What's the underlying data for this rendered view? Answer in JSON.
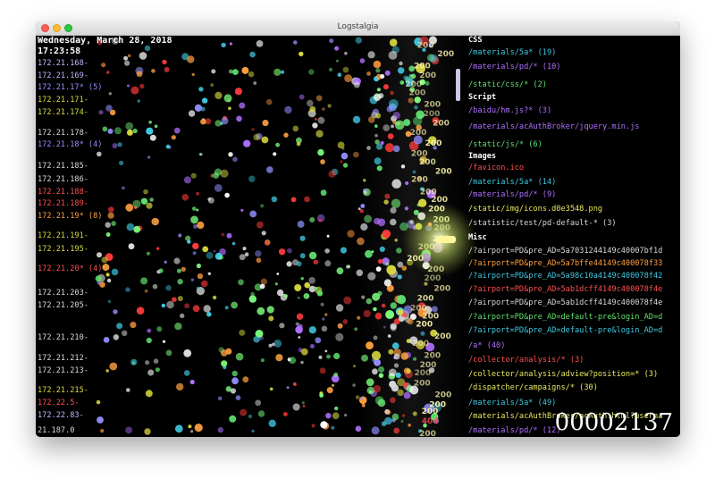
{
  "window": {
    "title": "Logstalgia"
  },
  "clock": {
    "date": "Wednesday, March 28, 2018",
    "time": "17:23:58"
  },
  "hosts": [
    {
      "label": "172.21.168-",
      "color": "#b8b8ff"
    },
    {
      "label": "172.21.169-",
      "color": "#b8b8ff"
    },
    {
      "label": "172.21.17* (5)",
      "color": "#9090ff"
    },
    {
      "label": "172.21.171-",
      "color": "#dada40"
    },
    {
      "label": "172.21.174-",
      "color": "#dada40"
    },
    {
      "label": "172.21.178-",
      "color": "#d8d8d8"
    },
    {
      "label": "172.21.18* (4)",
      "color": "#9090ff"
    },
    {
      "label": "172.21.185-",
      "color": "#d8d8d8"
    },
    {
      "label": "172.21.186-",
      "color": "#d8d8d8"
    },
    {
      "label": "172.21.188-",
      "color": "#ff5050"
    },
    {
      "label": "172.21.189-",
      "color": "#ff5050"
    },
    {
      "label": "172.21.19* (8)",
      "color": "#ffa040"
    },
    {
      "label": "172.21.191-",
      "color": "#dada40"
    },
    {
      "label": "172.21.195-",
      "color": "#dada40"
    },
    {
      "label": "172.21.20* (4)",
      "color": "#ff5050"
    },
    {
      "label": "172.21.203-",
      "color": "#d8d8d8"
    },
    {
      "label": "172.21.205-",
      "color": "#d8d8d8"
    },
    {
      "label": "172.21.210-",
      "color": "#d8d8d8"
    },
    {
      "label": "172.21.212-",
      "color": "#d8d8d8"
    },
    {
      "label": "172.21.213-",
      "color": "#d8d8d8"
    },
    {
      "label": "172.21.215-",
      "color": "#dada40"
    },
    {
      "label": "172.22.5-",
      "color": "#ff5050"
    },
    {
      "label": "172.22.83-",
      "color": "#b8b8ff"
    },
    {
      "label": "21.187.0",
      "color": "#d8d8d8"
    }
  ],
  "paths": [
    {
      "type": "header",
      "label": "CSS"
    },
    {
      "type": "path",
      "label": "/materials/5a* (19)",
      "color": "#40c8e0"
    },
    {
      "type": "path",
      "label": "/materials/pd/* (10)",
      "color": "#b070ff"
    },
    {
      "type": "path",
      "label": "/static/css/* (2)",
      "color": "#60e070"
    },
    {
      "type": "header",
      "label": "Script"
    },
    {
      "type": "path",
      "label": "/baidu/hm.js?* (3)",
      "color": "#b070ff"
    },
    {
      "type": "path",
      "label": "/materials/acAuthBroker/jquery.min.js",
      "color": "#b070ff"
    },
    {
      "type": "path",
      "label": "/static/js/* (6)",
      "color": "#60e070"
    },
    {
      "type": "header",
      "label": "Images"
    },
    {
      "type": "path",
      "label": "/favicon.ico",
      "color": "#ff5050"
    },
    {
      "type": "path",
      "label": "/materials/5a* (14)",
      "color": "#40c8e0"
    },
    {
      "type": "path",
      "label": "/materials/pd/* (9)",
      "color": "#b070ff"
    },
    {
      "type": "path",
      "label": "/static/img/icons.d0e3548.png",
      "color": "#e8e860"
    },
    {
      "type": "path",
      "label": "/statistic/test/pd-default-* (3)",
      "color": "#d8d8d8"
    },
    {
      "type": "header",
      "label": "Misc"
    },
    {
      "type": "path",
      "label": "/?airport=PD&pre_AD=5a7031244149c40007bf1d",
      "color": "#d8d8d8"
    },
    {
      "type": "path",
      "label": "/?airport=PD&pre_AD=5a7bffe44149c400078f33",
      "color": "#ffa040"
    },
    {
      "type": "path",
      "label": "/?airport=PD&pre_AD=5a98c10a4149c400078f42",
      "color": "#40c8e0"
    },
    {
      "type": "path",
      "label": "/?airport=PD&pre_AD=5ab1dcff4149c400078f4e",
      "color": "#ff5050"
    },
    {
      "type": "path",
      "label": "/?airport=PD&pre_AD=5ab1dcff4149c400078f4e",
      "color": "#d8d8d8"
    },
    {
      "type": "path",
      "label": "/?airport=PD&pre_AD=default-pre&login_AD=d",
      "color": "#60e070"
    },
    {
      "type": "path",
      "label": "/?airport=PD&pre_AD=default-pre&login_AD=d",
      "color": "#40c8e0"
    },
    {
      "type": "path",
      "label": "/a* (40)",
      "color": "#b070ff"
    },
    {
      "type": "path",
      "label": "/collector/analysis/* (3)",
      "color": "#ff5050"
    },
    {
      "type": "path",
      "label": "/collector/analysis/adview?position=* (3)",
      "color": "#e8e860"
    },
    {
      "type": "path",
      "label": "/dispatcher/campaigns/* (30)",
      "color": "#e8e860"
    },
    {
      "type": "path",
      "label": "/materials/5a* (49)",
      "color": "#40c8e0"
    },
    {
      "type": "path",
      "label": "/materials/acAuthBroker/acAuth.html?userna",
      "color": "#e8e860"
    },
    {
      "type": "path",
      "label": "/materials/pd/* (12)",
      "color": "#b070ff"
    }
  ],
  "counter": "00002137",
  "status_codes": [
    "200",
    "200",
    "200",
    "200",
    "200",
    "200",
    "200",
    "200",
    "200",
    "200",
    "200",
    "200",
    "200",
    "200",
    "200",
    "200",
    "200",
    "200",
    "200",
    "200",
    "200",
    "200",
    "200",
    "200",
    "200",
    "200",
    "200",
    "200",
    "200",
    "200",
    "200",
    "200",
    "200",
    "200",
    "200",
    "200",
    "200",
    "200",
    "200",
    "404",
    "200"
  ],
  "colors": {
    "background": "#000000",
    "paddle": "#fff59a",
    "ball_palette": [
      "#ff3b3b",
      "#ffffff",
      "#dada40",
      "#7fff7f",
      "#40c8e0",
      "#b070ff",
      "#ffa040",
      "#9090ff",
      "#d8d8d8",
      "#60e070"
    ]
  }
}
